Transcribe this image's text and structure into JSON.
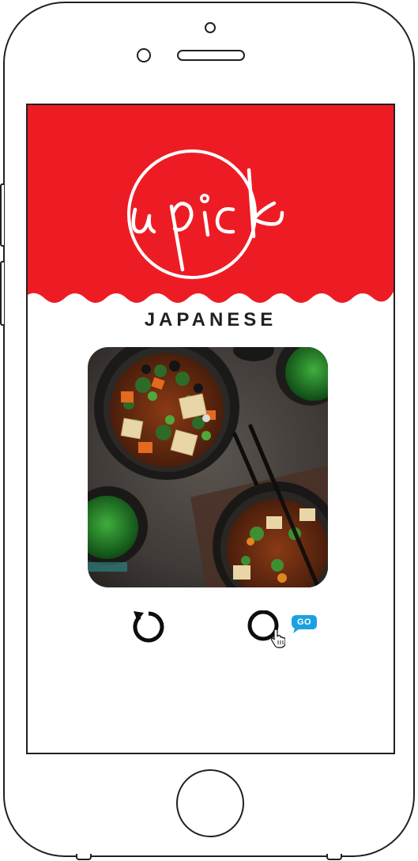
{
  "app": {
    "logo_text": "u pick",
    "brand_color": "#ed1c24"
  },
  "content": {
    "category": "JAPANESE",
    "photo_icon": "food-photo-miso-soup"
  },
  "actions": {
    "refresh_icon": "refresh-icon",
    "go_icon": "circle-go-icon",
    "go_label": "GO",
    "go_bubble_color": "#1ba1e2",
    "cursor_icon": "hand-cursor-icon"
  }
}
